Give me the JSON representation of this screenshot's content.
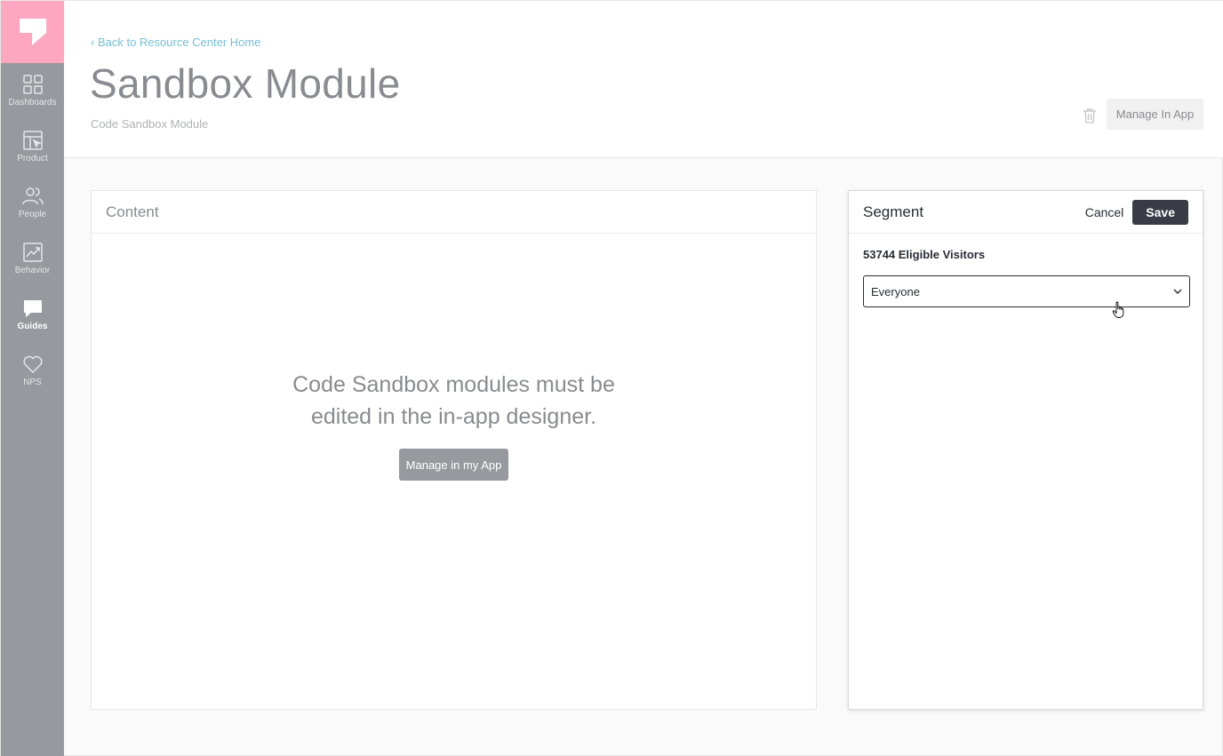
{
  "sidebar": {
    "logo_icon": "pendo-logo-icon",
    "items": [
      {
        "label": "Dashboards",
        "icon": "grid-icon",
        "active": false
      },
      {
        "label": "Product",
        "icon": "layout-cursor-icon",
        "active": false
      },
      {
        "label": "People",
        "icon": "people-icon",
        "active": false
      },
      {
        "label": "Behavior",
        "icon": "chart-trend-icon",
        "active": false
      },
      {
        "label": "Guides",
        "icon": "chat-bubble-icon",
        "active": true
      },
      {
        "label": "NPS",
        "icon": "heart-icon",
        "active": false
      }
    ]
  },
  "header": {
    "back_link": "‹ Back to Resource Center Home",
    "title": "Sandbox Module",
    "subtitle": "Code Sandbox Module",
    "manage_label": "Manage In App"
  },
  "content": {
    "heading": "Content",
    "message": "Code Sandbox modules must be edited in the in-app designer.",
    "button_label": "Manage in my App"
  },
  "segment": {
    "heading": "Segment",
    "cancel_label": "Cancel",
    "save_label": "Save",
    "eligible_text": "53744 Eligible Visitors",
    "selected": "Everyone"
  },
  "colors": {
    "sidebar": "#98999e",
    "logo_bg": "#ffa6c1",
    "link": "#75bfd6",
    "save_bg": "#3a3c45"
  }
}
